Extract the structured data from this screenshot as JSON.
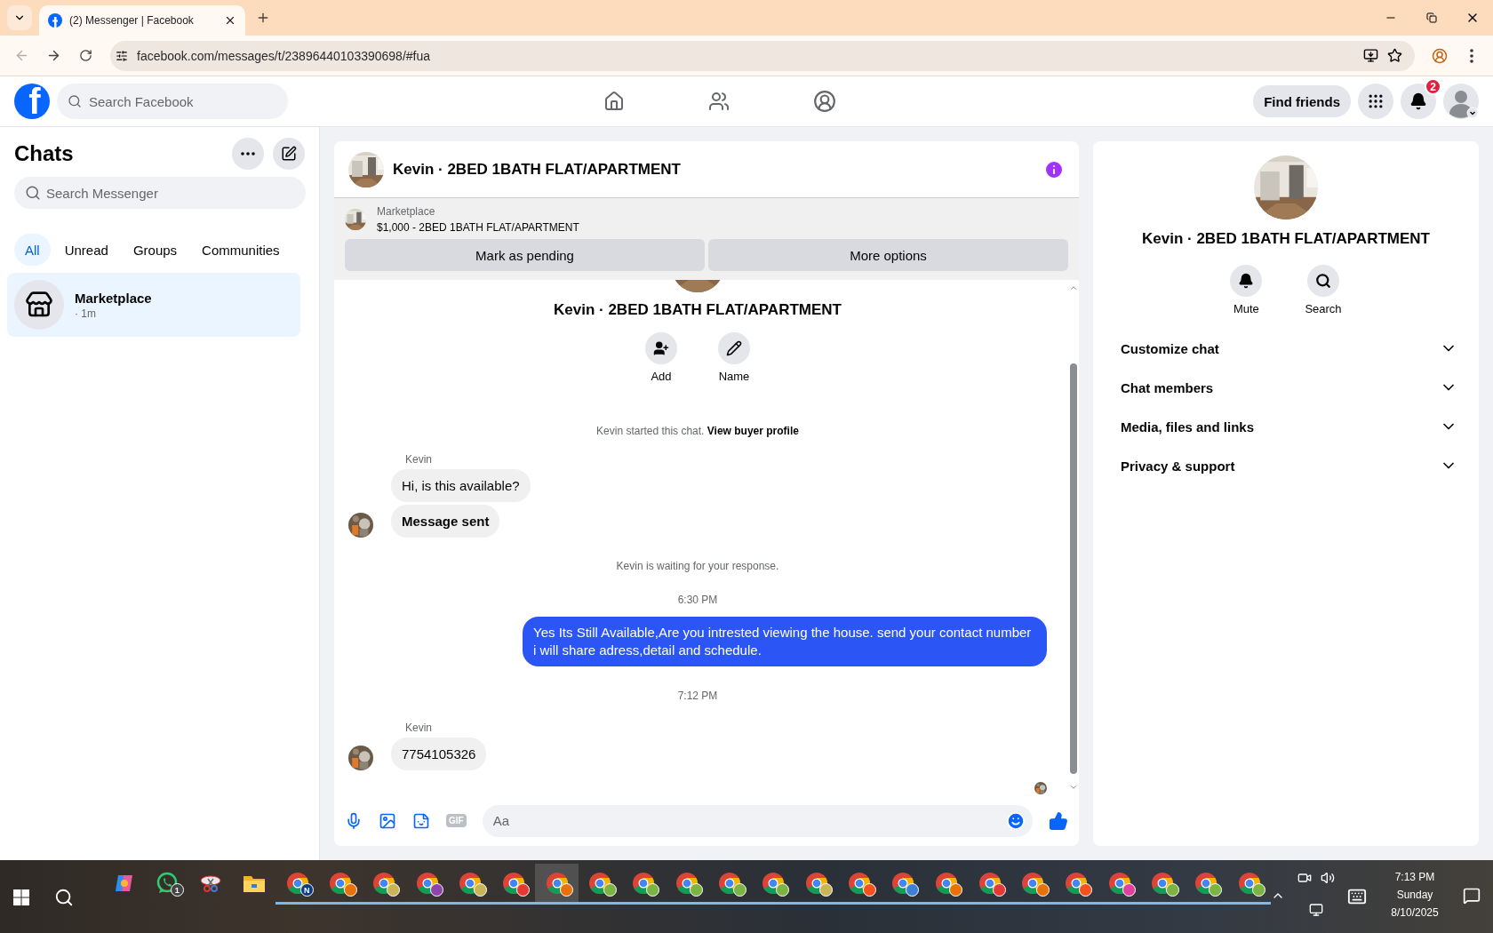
{
  "browser": {
    "tab": {
      "title": "(2) Messenger | Facebook"
    },
    "url": "facebook.com/messages/t/23896440103390698/#fua",
    "back_disabled": true
  },
  "header": {
    "logo": "f",
    "search": {
      "placeholder": "Search Facebook"
    },
    "find_friends": "Find friends",
    "notifications_badge": "2"
  },
  "sidebar": {
    "title": "Chats",
    "search": {
      "placeholder": "Search Messenger"
    },
    "filters": [
      {
        "label": "All",
        "selected": true
      },
      {
        "label": "Unread",
        "selected": false
      },
      {
        "label": "Groups",
        "selected": false
      },
      {
        "label": "Communities",
        "selected": false
      }
    ],
    "chats": [
      {
        "name": "Marketplace",
        "meta": "· 1m",
        "selected": true
      }
    ]
  },
  "chat": {
    "title": "Kevin · 2BED 1BATH FLAT/APARTMENT",
    "listing": {
      "label": "Marketplace",
      "price_title": "$1,000 - 2BED 1BATH FLAT/APARTMENT",
      "buttons": [
        "Mark as pending",
        "More options"
      ]
    },
    "intro": {
      "title": "Kevin · 2BED 1BATH FLAT/APARTMENT",
      "actions": [
        {
          "kind": "add",
          "label": "Add"
        },
        {
          "kind": "name",
          "label": "Name"
        }
      ]
    },
    "messages": [
      {
        "kind": "system",
        "text": "Kevin started this chat.",
        "link": "View buyer profile"
      },
      {
        "kind": "sender",
        "text": "Kevin"
      },
      {
        "kind": "incoming",
        "text": "Hi, is this available?",
        "avatar": false,
        "bold": false
      },
      {
        "kind": "incoming",
        "text": "Message sent",
        "avatar": true,
        "bold": true
      },
      {
        "kind": "system",
        "text": "Kevin is waiting for your response."
      },
      {
        "kind": "time",
        "text": "6:30 PM"
      },
      {
        "kind": "outgoing",
        "text": "Yes Its Still Available,Are you intrested viewing the house. send your contact number i will share adress,detail and schedule."
      },
      {
        "kind": "time",
        "text": "7:12 PM"
      },
      {
        "kind": "sender",
        "text": "Kevin"
      },
      {
        "kind": "incoming",
        "text": "7754105326",
        "avatar": true,
        "bold": false
      }
    ],
    "read_receipt": true,
    "composer": {
      "placeholder": "Aa",
      "gif": "GIF"
    }
  },
  "info": {
    "title": "Kevin · 2BED 1BATH FLAT/APARTMENT",
    "actions": [
      {
        "kind": "mute",
        "label": "Mute"
      },
      {
        "kind": "search",
        "label": "Search"
      }
    ],
    "sections": [
      {
        "label": "Customize chat",
        "expanded": false
      },
      {
        "label": "Chat members",
        "expanded": false
      },
      {
        "label": "Media, files and links",
        "expanded": false
      },
      {
        "label": "Privacy & support",
        "expanded": false
      }
    ]
  },
  "taskbar": {
    "apps": [
      {
        "kind": "copilot",
        "selected": false
      },
      {
        "kind": "whatsapp",
        "badge": "1",
        "selected": false
      },
      {
        "kind": "snip",
        "selected": false
      },
      {
        "kind": "explorer",
        "selected": false
      },
      {
        "kind": "chrome",
        "badge": "N",
        "color": "#0d3c84",
        "selected": false
      },
      {
        "kind": "chrome",
        "color": "#e8710a",
        "selected": false
      },
      {
        "kind": "chrome",
        "color": "#c9b458",
        "selected": false
      },
      {
        "kind": "chrome",
        "color": "#8e44ad",
        "selected": false
      },
      {
        "kind": "chrome",
        "color": "#c9b458",
        "selected": false
      },
      {
        "kind": "chrome",
        "color": "#e53935",
        "selected": false
      },
      {
        "kind": "chrome",
        "color": "#e8710a",
        "selected": true
      },
      {
        "kind": "chrome",
        "color": "#7cb342",
        "selected": false
      },
      {
        "kind": "chrome",
        "color": "#7cb342",
        "selected": false
      },
      {
        "kind": "chrome",
        "color": "#7cb342",
        "selected": false
      },
      {
        "kind": "chrome",
        "color": "#7cb342",
        "selected": false
      },
      {
        "kind": "chrome",
        "color": "#7cb342",
        "selected": false
      },
      {
        "kind": "chrome",
        "color": "#c9b458",
        "selected": false
      },
      {
        "kind": "chrome",
        "color": "#f4511e",
        "selected": false
      },
      {
        "kind": "chrome",
        "color": "#3f7fd8",
        "selected": false
      },
      {
        "kind": "chrome",
        "color": "#e8710a",
        "selected": false
      },
      {
        "kind": "chrome",
        "color": "#e53935",
        "selected": false
      },
      {
        "kind": "chrome",
        "color": "#e8710a",
        "selected": false
      },
      {
        "kind": "chrome",
        "color": "#f4511e",
        "selected": false
      },
      {
        "kind": "chrome",
        "color": "#e040a0",
        "selected": false
      },
      {
        "kind": "chrome",
        "color": "#7cb342",
        "selected": false
      },
      {
        "kind": "chrome",
        "color": "#7cb342",
        "selected": false
      },
      {
        "kind": "chrome",
        "color": "#7cb342",
        "selected": false
      }
    ],
    "time": "7:13 PM",
    "day": "Sunday",
    "date": "8/10/2025"
  }
}
